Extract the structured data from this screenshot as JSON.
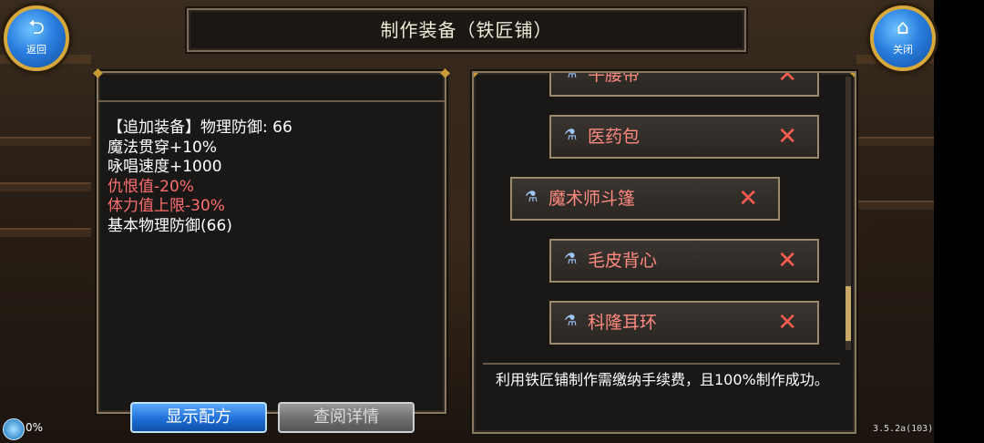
{
  "window": {
    "title": "制作装备（铁匠铺）"
  },
  "buttons": {
    "back_label": "返回",
    "close_label": "关闭",
    "show_recipe": "显示配方",
    "view_details": "查阅详情"
  },
  "description": {
    "lines": [
      {
        "text": "【追加装备】物理防御: 66",
        "color": "white"
      },
      {
        "text": "魔法贯穿+10%",
        "color": "white"
      },
      {
        "text": "咏唱速度+1000",
        "color": "white"
      },
      {
        "text": "仇恨值-20%",
        "color": "red"
      },
      {
        "text": "体力值上限-30%",
        "color": "red"
      },
      {
        "text": "基本物理防御(66)",
        "color": "white"
      }
    ]
  },
  "equipment_list": {
    "items": [
      {
        "name": "牛腰带",
        "selected": false
      },
      {
        "name": "医药包",
        "selected": false
      },
      {
        "name": "魔术师斗篷",
        "selected": true
      },
      {
        "name": "毛皮背心",
        "selected": false
      },
      {
        "name": "科隆耳环",
        "selected": false
      }
    ],
    "remove_symbol": "✕"
  },
  "info_text": "利用铁匠铺制作需缴纳手续费，且100%制作成功。",
  "status": {
    "percent": "0%"
  },
  "version": "3.5.2a(103)",
  "colors": {
    "accent_gold": "#d7a93d",
    "item_name": "#ff8a80",
    "remove_red": "#ff5c50",
    "penalty_red": "#ff6f6f",
    "button_blue": "#1f6fd8"
  },
  "icons": {
    "back": "back-arrow-icon",
    "close": "house-icon",
    "item": "potion-icon",
    "status": "globe-icon"
  }
}
